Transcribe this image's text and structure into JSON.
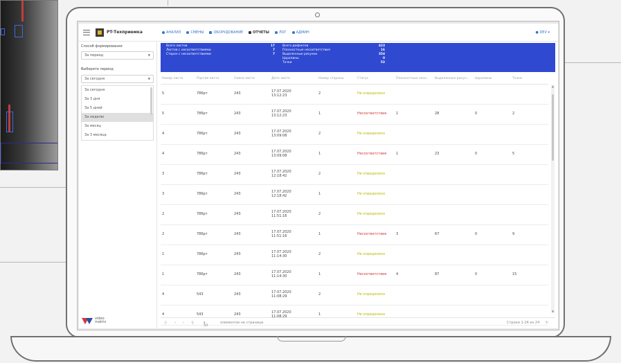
{
  "app": {
    "brand": "PT-Техприемка",
    "user": "DEV"
  },
  "nav": [
    {
      "id": "analysis",
      "label": "АНАЛИЗ",
      "icon": "chart-icon"
    },
    {
      "id": "shifts",
      "label": "СМЕНЫ",
      "icon": "clock-icon"
    },
    {
      "id": "equipment",
      "label": "ОБОРУДОВАНИЕ",
      "icon": "gear-icon"
    },
    {
      "id": "reports",
      "label": "ОТЧЕТЫ",
      "icon": "document-icon"
    },
    {
      "id": "log",
      "label": "ЛОГ",
      "icon": "history-icon"
    },
    {
      "id": "admin",
      "label": "АДМИН",
      "icon": "admin-icon"
    }
  ],
  "sidebar": {
    "method_label": "Способ формирования",
    "method_value": "За период",
    "period_label": "Выберите период",
    "period_value": "За сегодня",
    "options": [
      "За сегодня",
      "За 3 дня",
      "За 5 дней",
      "За неделю",
      "За месяц",
      "За 3 месяца"
    ],
    "selected_index": 3,
    "logo_line1": "video",
    "logo_line2": "matrix"
  },
  "summary": {
    "left": [
      {
        "label": "Всего листов",
        "value": "17"
      },
      {
        "label": "Листов с несоответствиями",
        "value": "7"
      },
      {
        "label": "Сторон с несоответствиями",
        "value": "7"
      }
    ],
    "right": [
      {
        "label": "Всего дефектов",
        "value": "423"
      },
      {
        "label": "Плоскостные несоответствия",
        "value": "16"
      },
      {
        "label": "Выделенные рисунки",
        "value": "354"
      },
      {
        "label": "Царапины",
        "value": "0"
      },
      {
        "label": "Точки",
        "value": "53"
      }
    ]
  },
  "table": {
    "columns": [
      "Номер листа",
      "Партия листа",
      "Смена листа",
      "Дата листа",
      "Номер стороны",
      "Статус",
      "Плоскостные несо...",
      "Выделенные рисун...",
      "Царапины",
      "Точки"
    ],
    "rows": [
      {
        "sheet": "5",
        "batch": "786pт",
        "shift": "243",
        "date": "17.07.2020",
        "time": "13:12:23",
        "side": "2",
        "status": "Не определено",
        "status_type": "neutral",
        "c1": "",
        "c2": "",
        "c3": "",
        "c4": ""
      },
      {
        "sheet": "5",
        "batch": "786pт",
        "shift": "243",
        "date": "17.07.2020",
        "time": "13:12:23",
        "side": "1",
        "status": "Несоответствие",
        "status_type": "bad",
        "c1": "1",
        "c2": "28",
        "c3": "0",
        "c4": "2"
      },
      {
        "sheet": "4",
        "batch": "786pт",
        "shift": "243",
        "date": "17.07.2020",
        "time": "13:09:08",
        "side": "2",
        "status": "Не определено",
        "status_type": "neutral",
        "c1": "",
        "c2": "",
        "c3": "",
        "c4": ""
      },
      {
        "sheet": "4",
        "batch": "786pт",
        "shift": "243",
        "date": "17.07.2020",
        "time": "13:09:08",
        "side": "1",
        "status": "Несоответствие",
        "status_type": "bad",
        "c1": "1",
        "c2": "23",
        "c3": "0",
        "c4": "5"
      },
      {
        "sheet": "3",
        "batch": "786pт",
        "shift": "243",
        "date": "17.07.2020",
        "time": "12:18:42",
        "side": "2",
        "status": "Не определено",
        "status_type": "neutral",
        "c1": "",
        "c2": "",
        "c3": "",
        "c4": ""
      },
      {
        "sheet": "3",
        "batch": "786pт",
        "shift": "243",
        "date": "17.07.2020",
        "time": "12:18:42",
        "side": "1",
        "status": "Не определено",
        "status_type": "neutral",
        "c1": "",
        "c2": "",
        "c3": "",
        "c4": ""
      },
      {
        "sheet": "2",
        "batch": "786pт",
        "shift": "243",
        "date": "17.07.2020",
        "time": "11:51:16",
        "side": "2",
        "status": "Не определено",
        "status_type": "neutral",
        "c1": "",
        "c2": "",
        "c3": "",
        "c4": ""
      },
      {
        "sheet": "2",
        "batch": "786pт",
        "shift": "243",
        "date": "17.07.2020",
        "time": "11:51:16",
        "side": "1",
        "status": "Несоответствие",
        "status_type": "bad",
        "c1": "3",
        "c2": "67",
        "c3": "0",
        "c4": "9"
      },
      {
        "sheet": "1",
        "batch": "786pт",
        "shift": "243",
        "date": "17.07.2020",
        "time": "11:14:30",
        "side": "2",
        "status": "Не определено",
        "status_type": "neutral",
        "c1": "",
        "c2": "",
        "c3": "",
        "c4": ""
      },
      {
        "sheet": "1",
        "batch": "786pт",
        "shift": "243",
        "date": "17.07.2020",
        "time": "11:14:30",
        "side": "1",
        "status": "Несоответствие",
        "status_type": "bad",
        "c1": "4",
        "c2": "87",
        "c3": "0",
        "c4": "15"
      },
      {
        "sheet": "4",
        "batch": "543",
        "shift": "243",
        "date": "17.07.2020",
        "time": "11:08:29",
        "side": "2",
        "status": "Не определено",
        "status_type": "neutral",
        "c1": "",
        "c2": "",
        "c3": "",
        "c4": ""
      },
      {
        "sheet": "4",
        "batch": "543",
        "shift": "243",
        "date": "17.07.2020",
        "time": "11:08:29",
        "side": "1",
        "status": "Не определено",
        "status_type": "neutral",
        "c1": "",
        "c2": "",
        "c3": "",
        "c4": ""
      }
    ]
  },
  "pager": {
    "first": "|‹",
    "prev": "‹",
    "next": "›",
    "last": "›|",
    "page_size": "50",
    "per_page_label": "элементов на странице",
    "range": "Строки 1-24 из 24"
  },
  "colors": {
    "summary_bg": "#2f49d1",
    "nav": "#3a73c9",
    "status_bad": "#d23a3a",
    "status_neutral": "#b8b800"
  }
}
